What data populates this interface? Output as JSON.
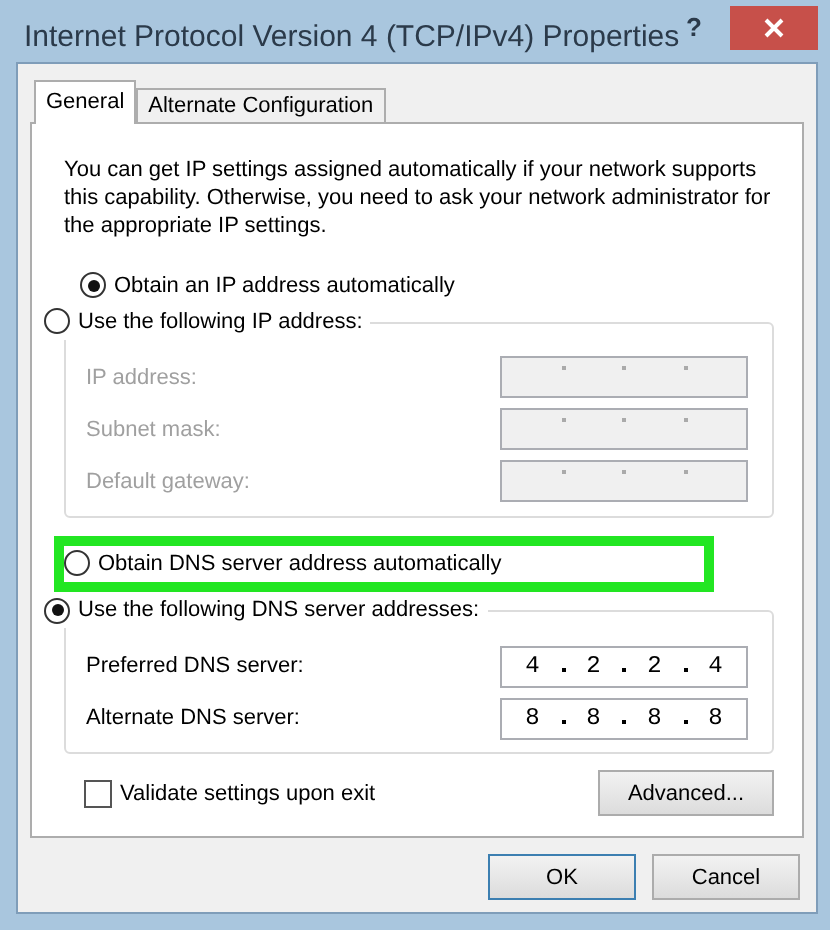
{
  "window": {
    "title": "Internet Protocol Version 4 (TCP/IPv4) Properties",
    "help": "?"
  },
  "tabs": [
    {
      "label": "General",
      "selected": true
    },
    {
      "label": "Alternate Configuration",
      "selected": false
    }
  ],
  "intro": "You can get IP settings assigned automatically if your network supports this capability. Otherwise, you need to ask your network administrator for the appropriate IP settings.",
  "ip_options": [
    {
      "label": "Obtain an IP address automatically",
      "selected": true
    },
    {
      "label": "Use the following IP address:",
      "selected": false
    }
  ],
  "ip_fields": [
    {
      "label": "IP address:",
      "disabled": true
    },
    {
      "label": "Subnet mask:",
      "disabled": true
    },
    {
      "label": "Default gateway:",
      "disabled": true
    }
  ],
  "dns_options": [
    {
      "label": "Obtain DNS server address automatically",
      "selected": false,
      "highlighted": true
    },
    {
      "label": "Use the following DNS server addresses:",
      "selected": true,
      "highlighted": false
    }
  ],
  "dns_fields": [
    {
      "label": "Preferred DNS server:",
      "disabled": false,
      "octets": [
        "4",
        "2",
        "2",
        "4"
      ]
    },
    {
      "label": "Alternate DNS server:",
      "disabled": false,
      "octets": [
        "8",
        "8",
        "8",
        "8"
      ]
    }
  ],
  "validate": {
    "label": "Validate settings upon exit",
    "checked": false
  },
  "advanced_button": "Advanced...",
  "buttons": [
    {
      "label": "OK",
      "default": true
    },
    {
      "label": "Cancel",
      "default": false
    }
  ]
}
